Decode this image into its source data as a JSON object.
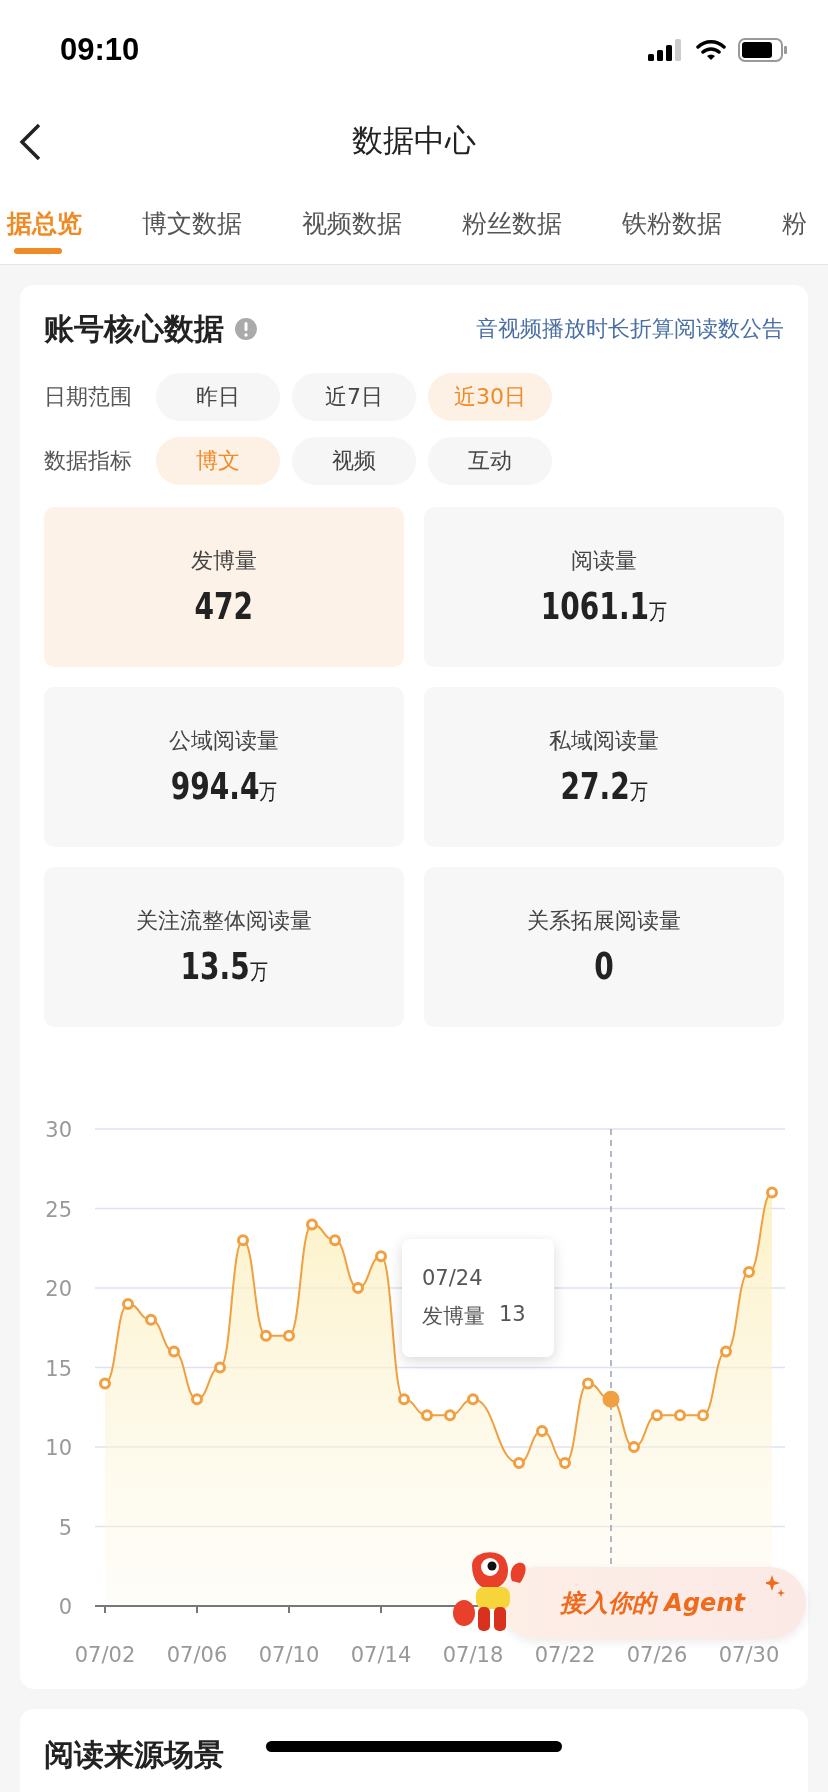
{
  "status_bar": {
    "time": "09:10"
  },
  "nav": {
    "title": "数据中心"
  },
  "tabs": [
    {
      "label": "据总览",
      "selected": true
    },
    {
      "label": "博文数据",
      "selected": false
    },
    {
      "label": "视频数据",
      "selected": false
    },
    {
      "label": "粉丝数据",
      "selected": false
    },
    {
      "label": "铁粉数据",
      "selected": false
    },
    {
      "label": "粉",
      "selected": false
    }
  ],
  "core_card": {
    "title": "账号核心数据",
    "notice_link": "音视频播放时长折算阅读数公告",
    "filters": [
      {
        "label": "日期范围",
        "options": [
          {
            "label": "昨日",
            "selected": false
          },
          {
            "label": "近7日",
            "selected": false
          },
          {
            "label": "近30日",
            "selected": true
          }
        ]
      },
      {
        "label": "数据指标",
        "options": [
          {
            "label": "博文",
            "selected": true
          },
          {
            "label": "视频",
            "selected": false
          },
          {
            "label": "互动",
            "selected": false
          }
        ]
      }
    ],
    "stats": [
      {
        "label": "发博量",
        "value": "472",
        "selected": true
      },
      {
        "label": "阅读量",
        "value": "1061.1",
        "unit": "万",
        "selected": false
      },
      {
        "label": "公域阅读量",
        "value": "994.4",
        "unit": "万",
        "selected": false
      },
      {
        "label": "私域阅读量",
        "value": "27.2",
        "unit": "万",
        "selected": false
      },
      {
        "label": "关注流整体阅读量",
        "value": "13.5",
        "unit": "万",
        "selected": false
      },
      {
        "label": "关系拓展阅读量",
        "value": "0",
        "selected": false
      }
    ],
    "chart_data": {
      "type": "area",
      "categories": [
        "07/02",
        null,
        null,
        null,
        "07/06",
        null,
        null,
        null,
        "07/10",
        null,
        null,
        null,
        "07/14",
        null,
        null,
        null,
        "07/18",
        null,
        null,
        null,
        "07/22",
        null,
        null,
        null,
        "07/26",
        null,
        null,
        null,
        "07/30",
        null
      ],
      "series": [
        {
          "name": "发博量",
          "color": "#f0a040",
          "values": [
            14,
            19,
            18,
            16,
            13,
            15,
            23,
            17,
            17,
            24,
            23,
            20,
            22,
            13,
            12,
            12,
            13,
            null,
            9,
            11,
            9,
            14,
            13,
            10,
            12,
            12,
            12,
            16,
            21,
            26
          ]
        }
      ],
      "ylim": [
        0,
        30
      ],
      "yticks": [
        0,
        5,
        10,
        15,
        20,
        25,
        30
      ],
      "grid": true,
      "annotations": [
        "07/24"
      ]
    },
    "tooltip": {
      "value": "13"
    },
    "agent_banner": {
      "label": "接入你的 Agent"
    }
  },
  "next_card": {
    "title": "阅读来源场景"
  }
}
